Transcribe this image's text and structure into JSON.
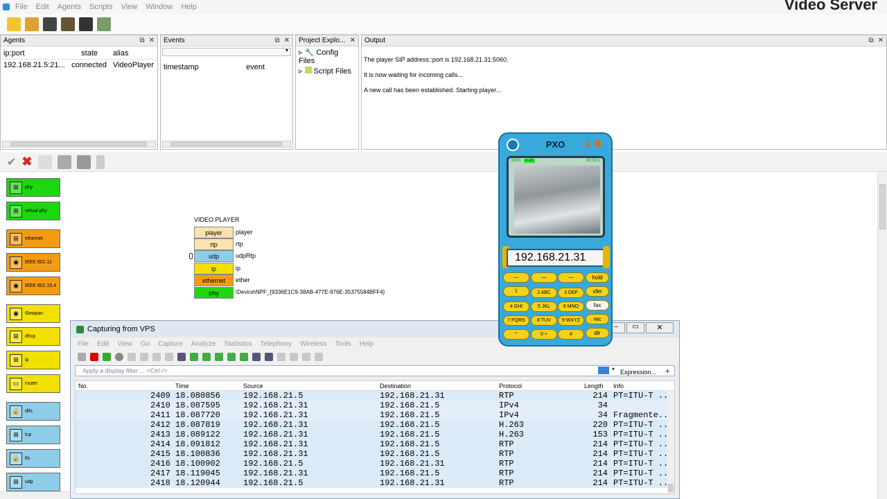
{
  "menubar": {
    "items": [
      "File",
      "Edit",
      "Agents",
      "Scripts",
      "View",
      "Window",
      "Help"
    ],
    "app_title": "Video Server"
  },
  "agents_panel": {
    "title": "Agents",
    "columns": [
      "ip:port",
      "state",
      "alias"
    ],
    "rows": [
      {
        "ipport": "192.168.21.5:21...",
        "state": "connected",
        "alias": "VideoPlayer"
      }
    ]
  },
  "events_panel": {
    "title": "Events",
    "columns": [
      "timestamp",
      "event"
    ]
  },
  "project_panel": {
    "title": "Project Explo...",
    "items": [
      "Config Files",
      "Script Files"
    ]
  },
  "output_panel": {
    "title": "Output",
    "lines": [
      "The player SIP address::port is 192.168.21.31:5060.",
      "It is now waiting for incoming calls...",
      "A new call has been established. Starting player..."
    ]
  },
  "palette": {
    "items": [
      "phy",
      "virtual phy",
      "ethernet",
      "IEEE 802.11",
      "IEEE 802.15.4",
      "6lowpan",
      "dhcp",
      "ip",
      "router",
      "dtls",
      "tcp",
      "tls",
      "udp"
    ]
  },
  "stack": {
    "title": "VIDEO PLAYER",
    "layers": [
      {
        "name": "player",
        "value": "player"
      },
      {
        "name": "rtp",
        "value": "rtp"
      },
      {
        "name": "udp",
        "value": "udpRtp"
      },
      {
        "name": "ip",
        "value": "ip"
      },
      {
        "name": "ethernet",
        "value": "ether"
      },
      {
        "name": "phy",
        "value": "\\Device\\NPF_{9336E1C9-38AB-477E-976E-35375584BFF4}"
      }
    ]
  },
  "wireshark": {
    "title": "Capturing from VPS",
    "menu": [
      "File",
      "Edit",
      "View",
      "Go",
      "Capture",
      "Analyze",
      "Statistics",
      "Telephony",
      "Wireless",
      "Tools",
      "Help"
    ],
    "filter_placeholder": "Apply a display filter ... <Ctrl-/>",
    "expression_label": "Expression...",
    "plus_label": "+",
    "columns": [
      "No.",
      "Time",
      "Source",
      "Destination",
      "Protocol",
      "Length",
      "Info"
    ],
    "packets": [
      {
        "no": "2409",
        "time": "18.080856",
        "src": "192.168.21.5",
        "dst": "192.168.21.31",
        "proto": "RTP",
        "len": "214",
        "info": "PT=ITU-T ..."
      },
      {
        "no": "2410",
        "time": "18.087595",
        "src": "192.168.21.31",
        "dst": "192.168.21.5",
        "proto": "IPv4",
        "len": "34",
        "info": ""
      },
      {
        "no": "2411",
        "time": "18.087720",
        "src": "192.168.21.31",
        "dst": "192.168.21.5",
        "proto": "IPv4",
        "len": "34",
        "info": "Fragmente..."
      },
      {
        "no": "2412",
        "time": "18.087819",
        "src": "192.168.21.31",
        "dst": "192.168.21.5",
        "proto": "H.263",
        "len": "220",
        "info": "PT=ITU-T ..."
      },
      {
        "no": "2413",
        "time": "18.089122",
        "src": "192.168.21.31",
        "dst": "192.168.21.5",
        "proto": "H.263",
        "len": "153",
        "info": "PT=ITU-T ..."
      },
      {
        "no": "2414",
        "time": "18.091812",
        "src": "192.168.21.31",
        "dst": "192.168.21.5",
        "proto": "RTP",
        "len": "214",
        "info": "PT=ITU-T ..."
      },
      {
        "no": "2415",
        "time": "18.100836",
        "src": "192.168.21.31",
        "dst": "192.168.21.5",
        "proto": "RTP",
        "len": "214",
        "info": "PT=ITU-T ..."
      },
      {
        "no": "2416",
        "time": "18.100902",
        "src": "192.168.21.5",
        "dst": "192.168.21.31",
        "proto": "RTP",
        "len": "214",
        "info": "PT=ITU-T ..."
      },
      {
        "no": "2417",
        "time": "18.119045",
        "src": "192.168.21.31",
        "dst": "192.168.21.5",
        "proto": "RTP",
        "len": "214",
        "info": "PT=ITU-T ..."
      },
      {
        "no": "2418",
        "time": "18.120944",
        "src": "192.168.21.5",
        "dst": "192.168.21.31",
        "proto": "RTP",
        "len": "214",
        "info": "PT=ITU-T ..."
      }
    ]
  },
  "phone": {
    "title": "PXO",
    "mos": "MOS",
    "mos_value": "4.43",
    "timer": "00:00:1",
    "ip": "192.168.21.31",
    "keys": [
      "1",
      "2 ABC",
      "3 DEF",
      "4 GHI",
      "5 JKL",
      "6 MNO",
      "7 PQRS",
      "8 TUV",
      "9 WXYZ",
      "*",
      "0 +",
      "# "
    ],
    "fkeys": [
      "hold",
      "xfer",
      "fax",
      "rec",
      "dir"
    ]
  }
}
